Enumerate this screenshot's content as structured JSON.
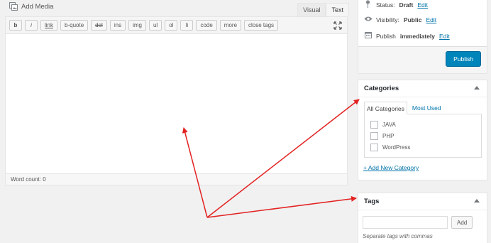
{
  "editor": {
    "add_media_label": "Add Media",
    "tabs": {
      "visual": "Visual",
      "text": "Text"
    },
    "toolbar_buttons": [
      "b",
      "i",
      "link",
      "b-quote",
      "del",
      "ins",
      "img",
      "ul",
      "ol",
      "li",
      "code",
      "more",
      "close tags"
    ],
    "word_count": "Word count: 0"
  },
  "publish": {
    "status_label": "Status:",
    "status_value": "Draft",
    "visibility_label": "Visibility:",
    "visibility_value": "Public",
    "publish_label": "Publish",
    "publish_value": "immediately",
    "edit_label": "Edit",
    "publish_button": "Publish"
  },
  "categories": {
    "title": "Categories",
    "tabs": {
      "all": "All Categories",
      "most_used": "Most Used"
    },
    "items": [
      "JAVA",
      "PHP",
      "WordPress"
    ],
    "add_new": "+ Add New Category"
  },
  "tags": {
    "title": "Tags",
    "add_button": "Add",
    "hint": "Separate tags with commas"
  },
  "colors": {
    "link": "#0073aa",
    "primary_button": "#0085ba",
    "annotation_arrow": "#e32222"
  },
  "icons": [
    "media-icon",
    "fullscreen-icon",
    "pin-icon",
    "eye-icon",
    "calendar-icon",
    "toggle-arrow-icon"
  ]
}
